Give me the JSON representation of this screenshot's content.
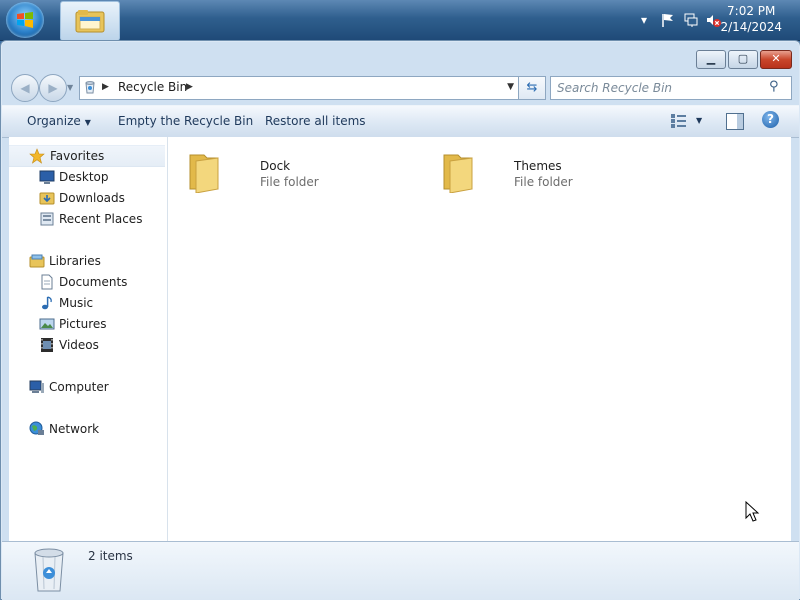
{
  "taskbar": {
    "clock_time": "7:02 PM",
    "clock_date": "2/14/2024",
    "tray_icons": [
      "show-hidden-icons-arrow",
      "action-center-flag-icon",
      "network-icon",
      "volume-muted-icon"
    ]
  },
  "window": {
    "title": "Recycle Bin",
    "caption_buttons": [
      "minimize",
      "maximize",
      "close"
    ]
  },
  "address_bar": {
    "crumb": "Recycle Bin"
  },
  "search": {
    "placeholder": "Search Recycle Bin"
  },
  "toolbar": {
    "organize": "Organize",
    "empty": "Empty the Recycle Bin",
    "restore": "Restore all items"
  },
  "nav_pane": {
    "favorites": "Favorites",
    "desktop": "Desktop",
    "downloads": "Downloads",
    "recent_places": "Recent Places",
    "libraries": "Libraries",
    "documents": "Documents",
    "music": "Music",
    "pictures": "Pictures",
    "videos": "Videos",
    "computer": "Computer",
    "network": "Network"
  },
  "items": [
    {
      "name": "Dock",
      "type": "File folder"
    },
    {
      "name": "Themes",
      "type": "File folder"
    }
  ],
  "details": {
    "count": "2 items"
  },
  "colors": {
    "taskbar": "#2f5f8e",
    "window_frame": "#cfe0f1",
    "toolbar_text": "#1e395b"
  }
}
